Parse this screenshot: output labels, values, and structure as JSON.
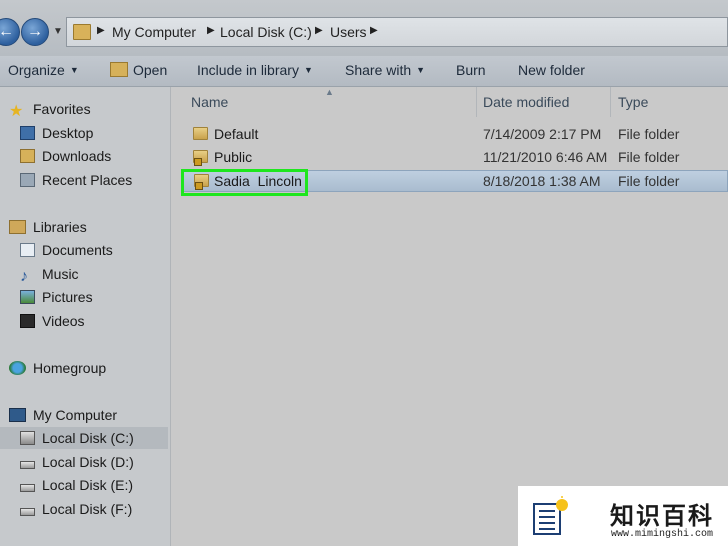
{
  "address_bar": {
    "breadcrumbs": [
      "My Computer",
      "Local Disk (C:)",
      "Users"
    ]
  },
  "toolbar": {
    "organize": "Organize",
    "open": "Open",
    "include_in_library": "Include in library",
    "share_with": "Share with",
    "burn": "Burn",
    "new_folder": "New folder"
  },
  "nav": {
    "favorites": "Favorites",
    "desktop": "Desktop",
    "downloads": "Downloads",
    "recent_places": "Recent Places",
    "libraries": "Libraries",
    "documents": "Documents",
    "music": "Music",
    "pictures": "Pictures",
    "videos": "Videos",
    "homegroup": "Homegroup",
    "my_computer": "My Computer",
    "disks": [
      "Local Disk (C:)",
      "Local Disk (D:)",
      "Local Disk (E:)",
      "Local Disk (F:)"
    ]
  },
  "columns": {
    "name": "Name",
    "date_modified": "Date modified",
    "type": "Type"
  },
  "files": [
    {
      "name": "Default",
      "date": "7/14/2009 2:17 PM",
      "type": "File folder"
    },
    {
      "name": "Public",
      "date": "11/21/2010 6:46 AM",
      "type": "File folder"
    },
    {
      "name": "Sadia  Lincoln",
      "date": "8/18/2018 1:38 AM",
      "type": "File folder"
    }
  ],
  "watermark": {
    "title": "知识百科",
    "url": "www.mimingshi.com"
  },
  "colors": {
    "highlight": "#1ee61e",
    "selection": "#a9bccf"
  }
}
